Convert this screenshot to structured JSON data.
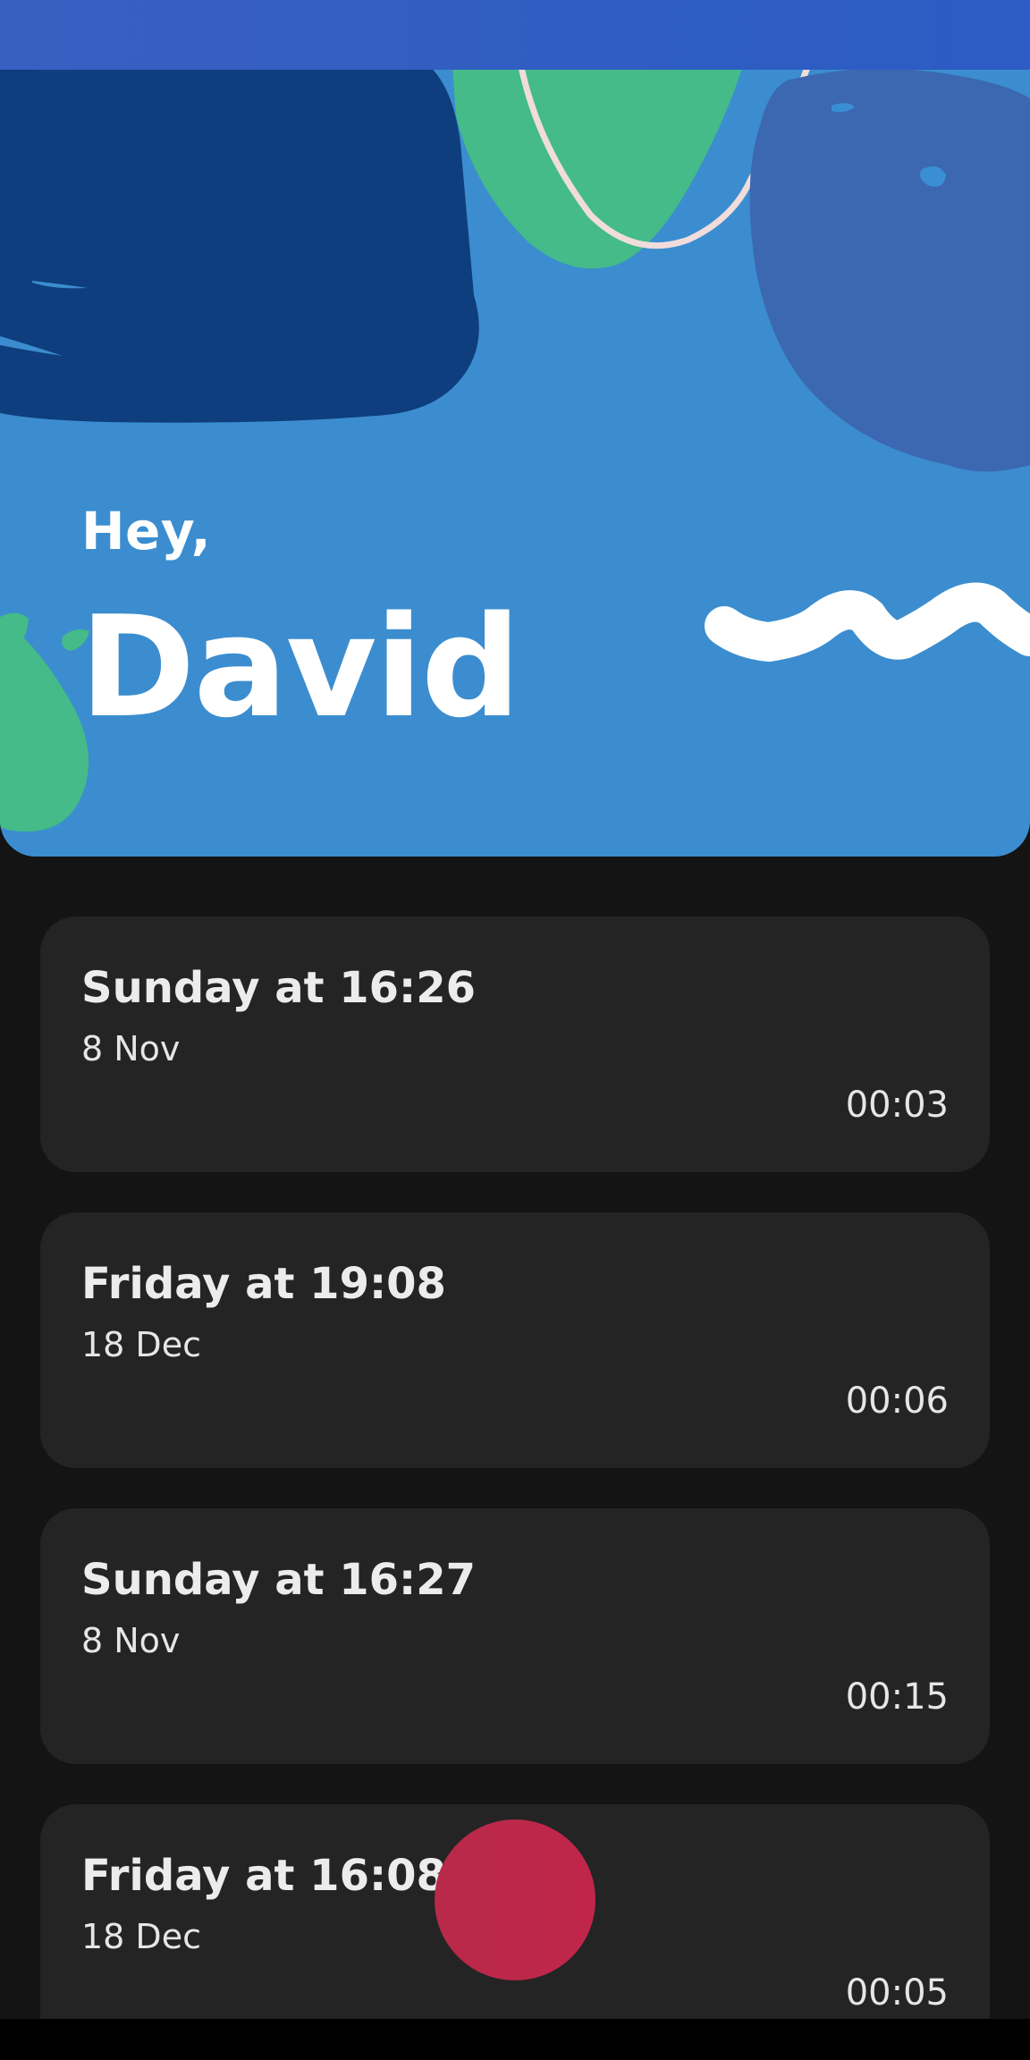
{
  "header": {
    "greeting": "Hey,",
    "name": "David"
  },
  "colors": {
    "hero_background": "#3b8dcf",
    "navy_blob": "#0e3e7d",
    "green_blob": "#44bb88",
    "purple_blob": "#3c68b1",
    "record_button": "#bb2849",
    "card_background": "#242424",
    "page_background": "#141414"
  },
  "recordings": [
    {
      "title": "Sunday at 16:26",
      "date": "8 Nov",
      "duration": "00:03"
    },
    {
      "title": "Friday at 19:08",
      "date": "18 Dec",
      "duration": "00:06"
    },
    {
      "title": "Sunday at 16:27",
      "date": "8 Nov",
      "duration": "00:15"
    },
    {
      "title": "Friday at 16:08",
      "date": "18 Dec",
      "duration": "00:05"
    }
  ],
  "record_button": {
    "icon": "record-circle"
  }
}
